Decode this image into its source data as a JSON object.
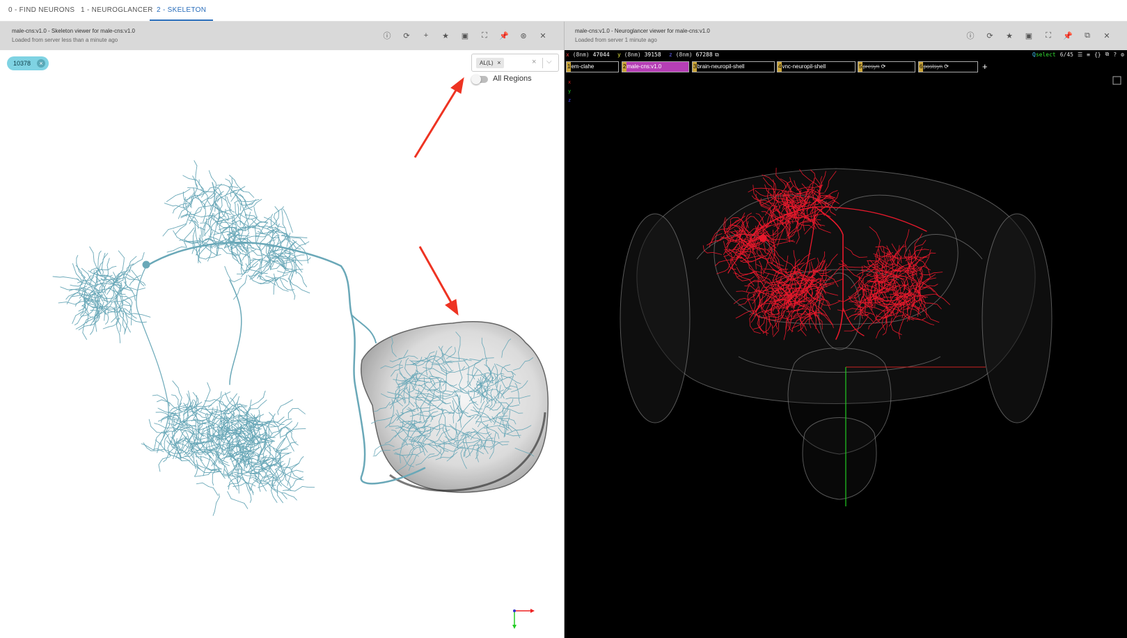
{
  "tabs": [
    {
      "label": "0 - FIND NEURONS"
    },
    {
      "label": "1 - NEUROGLANCER"
    },
    {
      "label": "2 - SKELETON"
    }
  ],
  "skeleton_panel": {
    "title": "male-cns:v1.0 - Skeleton viewer for male-cns:v1.0",
    "subtitle": "Loaded from server less than a minute ago",
    "icons": [
      "info-icon",
      "refresh-icon",
      "add-icon",
      "star-icon",
      "save-icon",
      "fullscreen-icon",
      "pin-icon",
      "sync-icon",
      "close-icon"
    ],
    "chip": "10378",
    "region_select": {
      "selected_tag": "AL(L)"
    },
    "toggle_label": "All Regions",
    "toggle_on": false,
    "colors": {
      "skeleton": "#6aa8b8",
      "arrow": "#ee3322"
    }
  },
  "ng_panel": {
    "title": "male-cns:v1.0 - Neuroglancer viewer for male-cns:v1.0",
    "subtitle": "Loaded from server 1 minute ago",
    "icons": [
      "info-icon",
      "refresh-icon",
      "star-icon",
      "save-icon",
      "fullscreen-icon",
      "pin-icon",
      "external-link-icon",
      "close-icon"
    ],
    "coords": [
      {
        "axis": "x",
        "unit": "8nm",
        "value": "47044"
      },
      {
        "axis": "y",
        "unit": "8nm",
        "value": "39158"
      },
      {
        "axis": "z",
        "unit": "8nm",
        "value": "67288"
      }
    ],
    "layers": [
      {
        "num": "1",
        "name": "em-clahe",
        "on": true,
        "selected": false
      },
      {
        "num": "2",
        "name": "male-cns:v1.0",
        "on": true,
        "selected": true
      },
      {
        "num": "3",
        "name": "brain-neuropil-shell",
        "on": true,
        "selected": false
      },
      {
        "num": "4",
        "name": "vnc-neuropil-shell",
        "on": true,
        "selected": false
      },
      {
        "num": "5",
        "name": "presyn",
        "on": false,
        "selected": false
      },
      {
        "num": "6",
        "name": "postsyn",
        "on": false,
        "selected": false
      }
    ],
    "status": {
      "mode": "select",
      "count": "6/45"
    },
    "colors": {
      "neuron": "#e8192c",
      "shell": "#9a9a9a",
      "axis_red": "#cc2222",
      "axis_green": "#22cc22"
    }
  }
}
